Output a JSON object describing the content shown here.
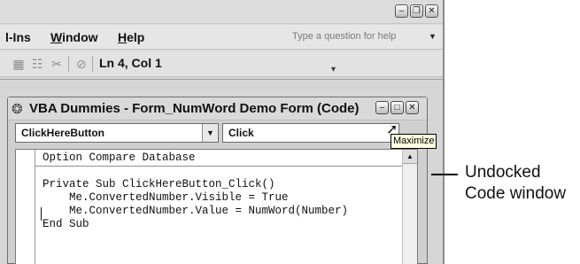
{
  "titlebar": {
    "buttons": [
      "minimize-icon",
      "restore-icon",
      "close-icon"
    ]
  },
  "menubar": {
    "items": [
      {
        "label": "l-Ins"
      },
      {
        "mnemonic": "W",
        "rest": "indow"
      },
      {
        "mnemonic": "H",
        "rest": "elp"
      }
    ],
    "help_placeholder": "Type a question for help"
  },
  "toolbar": {
    "icons": [
      "project-explorer-icon",
      "properties-window-icon",
      "toolbox-icon",
      "help-icon"
    ],
    "position": "Ln 4, Col 1"
  },
  "code_window": {
    "title": "VBA Dummies - Form_NumWord Demo Form (Code)",
    "object_combo": "ClickHereButton",
    "procedure_combo": "Click",
    "code_lines": [
      "Option Compare Database",
      "",
      "Private Sub ClickHereButton_Click()",
      "    Me.ConvertedNumber.Visible = True",
      "    Me.ConvertedNumber.Value = NumWord(Number)",
      "End Sub"
    ]
  },
  "tooltip": "Maximize",
  "annotation": {
    "line1": "Undocked",
    "line2": "Code window"
  }
}
